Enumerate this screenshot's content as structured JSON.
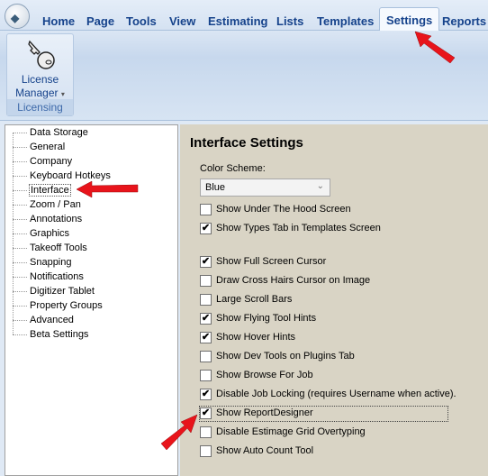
{
  "ribbon": {
    "tabs": [
      "Home",
      "Page",
      "Tools",
      "View",
      "Estimating",
      "Lists",
      "Templates",
      "Settings",
      "Reports"
    ],
    "active_tab": "Settings",
    "group": {
      "button_line1": "License",
      "button_line2": "Manager",
      "dropdown": "▾",
      "label": "Licensing",
      "icon": "key-icon"
    }
  },
  "tree": {
    "items": [
      "Data Storage",
      "General",
      "Company",
      "Keyboard Hotkeys",
      "Interface",
      "Zoom / Pan",
      "Annotations",
      "Graphics",
      "Takeoff Tools",
      "Snapping",
      "Notifications",
      "Digitizer Tablet",
      "Property Groups",
      "Advanced",
      "Beta Settings"
    ],
    "selected": "Interface"
  },
  "panel": {
    "title": "Interface Settings",
    "color_scheme_label": "Color Scheme:",
    "color_scheme_value": "Blue",
    "checkboxes": [
      {
        "label": "Show Under The Hood Screen",
        "checked": false
      },
      {
        "label": "Show Types Tab in Templates Screen",
        "checked": true
      },
      {
        "label": "Show Full Screen Cursor",
        "checked": true
      },
      {
        "label": "Draw Cross Hairs Cursor on Image",
        "checked": false
      },
      {
        "label": "Large Scroll Bars",
        "checked": false
      },
      {
        "label": "Show Flying Tool Hints",
        "checked": true
      },
      {
        "label": "Show Hover Hints",
        "checked": true
      },
      {
        "label": "Show Dev Tools on Plugins Tab",
        "checked": false
      },
      {
        "label": "Show Browse For Job",
        "checked": false
      },
      {
        "label": "Disable Job Locking (requires Username when active).",
        "checked": true
      },
      {
        "label": "Show ReportDesigner",
        "checked": true
      },
      {
        "label": "Disable Estimage Grid Overtyping",
        "checked": false
      },
      {
        "label": "Show Auto Count Tool",
        "checked": false
      }
    ]
  },
  "colors": {
    "annotation_arrow": "#e8141b",
    "panel_bg": "#d9d4c5",
    "ribbon_text": "#15428b"
  }
}
